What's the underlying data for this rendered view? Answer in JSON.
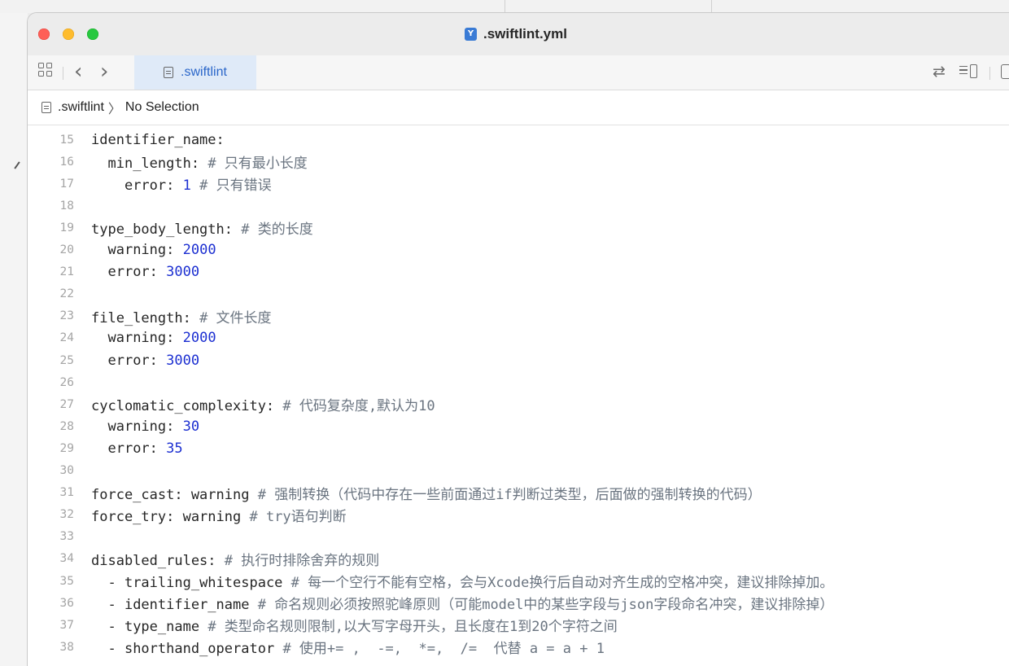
{
  "window": {
    "title": ".swiftlint.yml",
    "title_badge": "Y"
  },
  "tabbar": {
    "active_tab": ".swiftlint"
  },
  "breadcrumb": {
    "file": ".swiftlint",
    "selection": "No Selection"
  },
  "editor": {
    "lines": [
      {
        "no": "15",
        "indent": "",
        "key": "identifier_name:",
        "value": "",
        "comment": ""
      },
      {
        "no": "16",
        "indent": "  ",
        "key": "min_length:",
        "value": "",
        "comment": "# 只有最小长度"
      },
      {
        "no": "17",
        "indent": "    ",
        "key": "error:",
        "value": "1",
        "comment": "# 只有错误"
      },
      {
        "no": "18",
        "indent": "",
        "key": "",
        "value": "",
        "comment": ""
      },
      {
        "no": "19",
        "indent": "",
        "key": "type_body_length:",
        "value": "",
        "comment": "# 类的长度"
      },
      {
        "no": "20",
        "indent": "  ",
        "key": "warning:",
        "value": "2000",
        "comment": ""
      },
      {
        "no": "21",
        "indent": "  ",
        "key": "error:",
        "value": "3000",
        "comment": ""
      },
      {
        "no": "22",
        "indent": "",
        "key": "",
        "value": "",
        "comment": ""
      },
      {
        "no": "23",
        "indent": "",
        "key": "file_length:",
        "value": "",
        "comment": "# 文件长度"
      },
      {
        "no": "24",
        "indent": "  ",
        "key": "warning:",
        "value": "2000",
        "comment": ""
      },
      {
        "no": "25",
        "indent": "  ",
        "key": "error:",
        "value": "3000",
        "comment": ""
      },
      {
        "no": "26",
        "indent": "",
        "key": "",
        "value": "",
        "comment": ""
      },
      {
        "no": "27",
        "indent": "",
        "key": "cyclomatic_complexity:",
        "value": "",
        "comment": "# 代码复杂度,默认为10"
      },
      {
        "no": "28",
        "indent": "  ",
        "key": "warning:",
        "value": "30",
        "comment": ""
      },
      {
        "no": "29",
        "indent": "  ",
        "key": "error:",
        "value": "35",
        "comment": ""
      },
      {
        "no": "30",
        "indent": "",
        "key": "",
        "value": "",
        "comment": ""
      },
      {
        "no": "31",
        "indent": "",
        "key": "force_cast: warning",
        "value": "",
        "comment": "# 强制转换（代码中存在一些前面通过if判断过类型，后面做的强制转换的代码）"
      },
      {
        "no": "32",
        "indent": "",
        "key": "force_try: warning",
        "value": "",
        "comment": "# try语句判断"
      },
      {
        "no": "33",
        "indent": "",
        "key": "",
        "value": "",
        "comment": ""
      },
      {
        "no": "34",
        "indent": "",
        "key": "disabled_rules:",
        "value": "",
        "comment": "# 执行时排除舍弃的规则"
      },
      {
        "no": "35",
        "indent": "  ",
        "key": "- trailing_whitespace",
        "value": "",
        "comment": "# 每一个空行不能有空格，会与Xcode换行后自动对齐生成的空格冲突，建议排除掉加。"
      },
      {
        "no": "36",
        "indent": "  ",
        "key": "- identifier_name",
        "value": "",
        "comment": "# 命名规则必须按照驼峰原则（可能model中的某些字段与json字段命名冲突，建议排除掉）"
      },
      {
        "no": "37",
        "indent": "  ",
        "key": "- type_name",
        "value": "",
        "comment": "# 类型命名规则限制,以大写字母开头，且长度在1到20个字符之间"
      },
      {
        "no": "38",
        "indent": "  ",
        "key": "- shorthand_operator",
        "value": "",
        "comment": "# 使用+= ,  -=,  *=,  /=  代替 a = a + 1"
      }
    ]
  }
}
